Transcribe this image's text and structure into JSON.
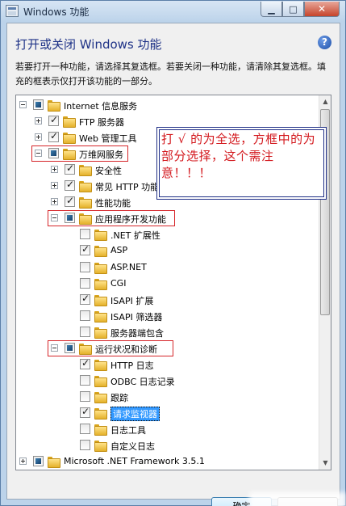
{
  "window": {
    "title": "Windows 功能"
  },
  "dialog": {
    "heading": "打开或关闭 Windows 功能",
    "description": "若要打开一种功能，请选择其复选框。若要关闭一种功能，请清除其复选框。填充的框表示仅打开该功能的一部分。"
  },
  "tree": {
    "items": [
      {
        "label": "Internet 信息服务",
        "state": "partial",
        "expander": "minus"
      },
      {
        "label": "FTP 服务器",
        "state": "checked",
        "expander": "plus"
      },
      {
        "label": "Web 管理工具",
        "state": "checked",
        "expander": "plus"
      },
      {
        "label": "万维网服务",
        "state": "partial",
        "expander": "minus"
      },
      {
        "label": "安全性",
        "state": "checked",
        "expander": "plus"
      },
      {
        "label": "常见 HTTP 功能",
        "state": "checked",
        "expander": "plus"
      },
      {
        "label": "性能功能",
        "state": "checked",
        "expander": "plus"
      },
      {
        "label": "应用程序开发功能",
        "state": "partial",
        "expander": "minus"
      },
      {
        "label": ".NET 扩展性",
        "state": "unchecked",
        "expander": "none"
      },
      {
        "label": "ASP",
        "state": "checked",
        "expander": "none"
      },
      {
        "label": "ASP.NET",
        "state": "unchecked",
        "expander": "none"
      },
      {
        "label": "CGI",
        "state": "unchecked",
        "expander": "none"
      },
      {
        "label": "ISAPI 扩展",
        "state": "checked",
        "expander": "none"
      },
      {
        "label": "ISAPI 筛选器",
        "state": "unchecked",
        "expander": "none"
      },
      {
        "label": "服务器端包含",
        "state": "unchecked",
        "expander": "none"
      },
      {
        "label": "运行状况和诊断",
        "state": "partial",
        "expander": "minus"
      },
      {
        "label": "HTTP 日志",
        "state": "checked",
        "expander": "none"
      },
      {
        "label": "ODBC 日志记录",
        "state": "unchecked",
        "expander": "none"
      },
      {
        "label": "跟踪",
        "state": "unchecked",
        "expander": "none"
      },
      {
        "label": "请求监视器",
        "state": "checked",
        "expander": "none",
        "selected": true
      },
      {
        "label": "日志工具",
        "state": "unchecked",
        "expander": "none"
      },
      {
        "label": "自定义日志",
        "state": "unchecked",
        "expander": "none"
      },
      {
        "label": "Microsoft .NET Framework 3.5.1",
        "state": "partial",
        "expander": "plus"
      }
    ]
  },
  "annotation": {
    "text": "打 √ 的为全选，方框中的为部分选择，这个需注意！！！"
  },
  "buttons": {
    "ok_label": "确定"
  },
  "colors": {
    "annotation_text": "#d3171c",
    "highlight_box": "#d6262a",
    "selection": "#3399ff"
  }
}
